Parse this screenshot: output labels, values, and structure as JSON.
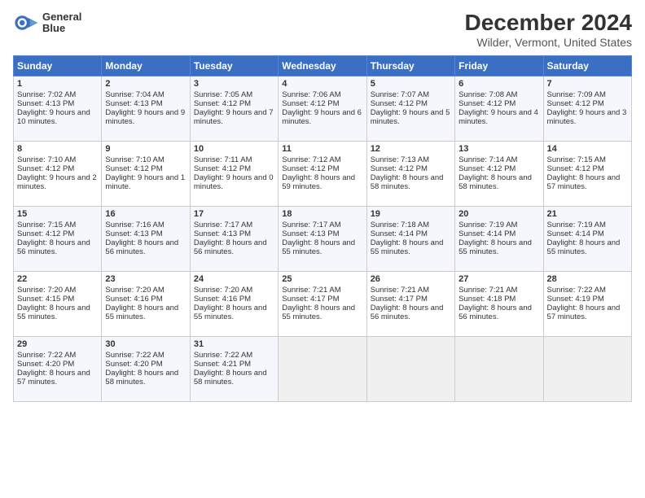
{
  "logo": {
    "line1": "General",
    "line2": "Blue"
  },
  "title": "December 2024",
  "subtitle": "Wilder, Vermont, United States",
  "days_of_week": [
    "Sunday",
    "Monday",
    "Tuesday",
    "Wednesday",
    "Thursday",
    "Friday",
    "Saturday"
  ],
  "weeks": [
    [
      {
        "day": "1",
        "sunrise": "7:02 AM",
        "sunset": "4:13 PM",
        "daylight": "9 hours and 10 minutes."
      },
      {
        "day": "2",
        "sunrise": "7:04 AM",
        "sunset": "4:13 PM",
        "daylight": "9 hours and 9 minutes."
      },
      {
        "day": "3",
        "sunrise": "7:05 AM",
        "sunset": "4:12 PM",
        "daylight": "9 hours and 7 minutes."
      },
      {
        "day": "4",
        "sunrise": "7:06 AM",
        "sunset": "4:12 PM",
        "daylight": "9 hours and 6 minutes."
      },
      {
        "day": "5",
        "sunrise": "7:07 AM",
        "sunset": "4:12 PM",
        "daylight": "9 hours and 5 minutes."
      },
      {
        "day": "6",
        "sunrise": "7:08 AM",
        "sunset": "4:12 PM",
        "daylight": "9 hours and 4 minutes."
      },
      {
        "day": "7",
        "sunrise": "7:09 AM",
        "sunset": "4:12 PM",
        "daylight": "9 hours and 3 minutes."
      }
    ],
    [
      {
        "day": "8",
        "sunrise": "7:10 AM",
        "sunset": "4:12 PM",
        "daylight": "9 hours and 2 minutes."
      },
      {
        "day": "9",
        "sunrise": "7:10 AM",
        "sunset": "4:12 PM",
        "daylight": "9 hours and 1 minute."
      },
      {
        "day": "10",
        "sunrise": "7:11 AM",
        "sunset": "4:12 PM",
        "daylight": "9 hours and 0 minutes."
      },
      {
        "day": "11",
        "sunrise": "7:12 AM",
        "sunset": "4:12 PM",
        "daylight": "8 hours and 59 minutes."
      },
      {
        "day": "12",
        "sunrise": "7:13 AM",
        "sunset": "4:12 PM",
        "daylight": "8 hours and 58 minutes."
      },
      {
        "day": "13",
        "sunrise": "7:14 AM",
        "sunset": "4:12 PM",
        "daylight": "8 hours and 58 minutes."
      },
      {
        "day": "14",
        "sunrise": "7:15 AM",
        "sunset": "4:12 PM",
        "daylight": "8 hours and 57 minutes."
      }
    ],
    [
      {
        "day": "15",
        "sunrise": "7:15 AM",
        "sunset": "4:12 PM",
        "daylight": "8 hours and 56 minutes."
      },
      {
        "day": "16",
        "sunrise": "7:16 AM",
        "sunset": "4:13 PM",
        "daylight": "8 hours and 56 minutes."
      },
      {
        "day": "17",
        "sunrise": "7:17 AM",
        "sunset": "4:13 PM",
        "daylight": "8 hours and 56 minutes."
      },
      {
        "day": "18",
        "sunrise": "7:17 AM",
        "sunset": "4:13 PM",
        "daylight": "8 hours and 55 minutes."
      },
      {
        "day": "19",
        "sunrise": "7:18 AM",
        "sunset": "4:14 PM",
        "daylight": "8 hours and 55 minutes."
      },
      {
        "day": "20",
        "sunrise": "7:19 AM",
        "sunset": "4:14 PM",
        "daylight": "8 hours and 55 minutes."
      },
      {
        "day": "21",
        "sunrise": "7:19 AM",
        "sunset": "4:14 PM",
        "daylight": "8 hours and 55 minutes."
      }
    ],
    [
      {
        "day": "22",
        "sunrise": "7:20 AM",
        "sunset": "4:15 PM",
        "daylight": "8 hours and 55 minutes."
      },
      {
        "day": "23",
        "sunrise": "7:20 AM",
        "sunset": "4:16 PM",
        "daylight": "8 hours and 55 minutes."
      },
      {
        "day": "24",
        "sunrise": "7:20 AM",
        "sunset": "4:16 PM",
        "daylight": "8 hours and 55 minutes."
      },
      {
        "day": "25",
        "sunrise": "7:21 AM",
        "sunset": "4:17 PM",
        "daylight": "8 hours and 55 minutes."
      },
      {
        "day": "26",
        "sunrise": "7:21 AM",
        "sunset": "4:17 PM",
        "daylight": "8 hours and 56 minutes."
      },
      {
        "day": "27",
        "sunrise": "7:21 AM",
        "sunset": "4:18 PM",
        "daylight": "8 hours and 56 minutes."
      },
      {
        "day": "28",
        "sunrise": "7:22 AM",
        "sunset": "4:19 PM",
        "daylight": "8 hours and 57 minutes."
      }
    ],
    [
      {
        "day": "29",
        "sunrise": "7:22 AM",
        "sunset": "4:20 PM",
        "daylight": "8 hours and 57 minutes."
      },
      {
        "day": "30",
        "sunrise": "7:22 AM",
        "sunset": "4:20 PM",
        "daylight": "8 hours and 58 minutes."
      },
      {
        "day": "31",
        "sunrise": "7:22 AM",
        "sunset": "4:21 PM",
        "daylight": "8 hours and 58 minutes."
      },
      null,
      null,
      null,
      null
    ]
  ],
  "labels": {
    "sunrise": "Sunrise:",
    "sunset": "Sunset:",
    "daylight": "Daylight:"
  }
}
